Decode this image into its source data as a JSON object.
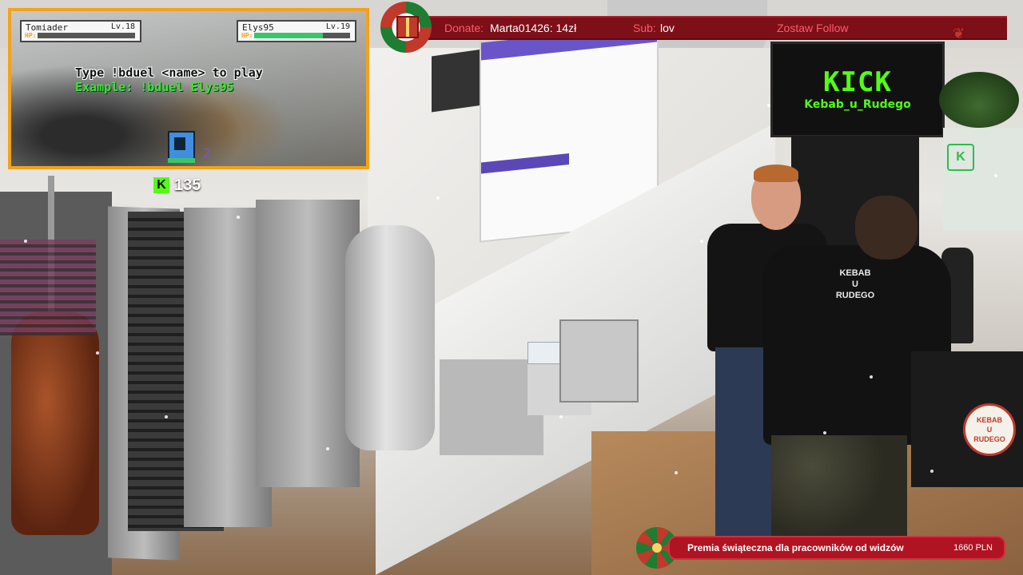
{
  "game": {
    "player1": {
      "name": "Tomiader",
      "level": "Lv.18",
      "hp_label": "HP:",
      "hp_fraction": 0.0
    },
    "player2": {
      "name": "Elys95",
      "level": "Lv.19",
      "hp_label": "HP:",
      "hp_fraction": 0.72
    },
    "instruction": "Type !bduel <name> to play",
    "example": "Example: !bduel Elys95",
    "sprite_count": "2"
  },
  "kick_counter": {
    "icon": "K",
    "value": "135"
  },
  "ticker": {
    "donate_label": "Donate:",
    "donate_value": "Marta01426: 14zł",
    "sub_label": "Sub:",
    "sub_value": "lov",
    "follow_text": "Zostaw Follow"
  },
  "scene": {
    "tv_logo": "KICK",
    "tv_channel": "Kebab_u_Rudego",
    "shirt_text": "KEBAB\nU\nRUDEGO",
    "badge_text": "KEBAB\nU\nRUDEGO"
  },
  "goal": {
    "title": "Premia świąteczna dla pracowników od widzów",
    "amount": "1660 PLN"
  },
  "colors": {
    "overlay_orange": "#f4a21a",
    "ticker_red": "#7d0f18",
    "goal_red": "#b01322",
    "kick_green": "#53fc18"
  }
}
